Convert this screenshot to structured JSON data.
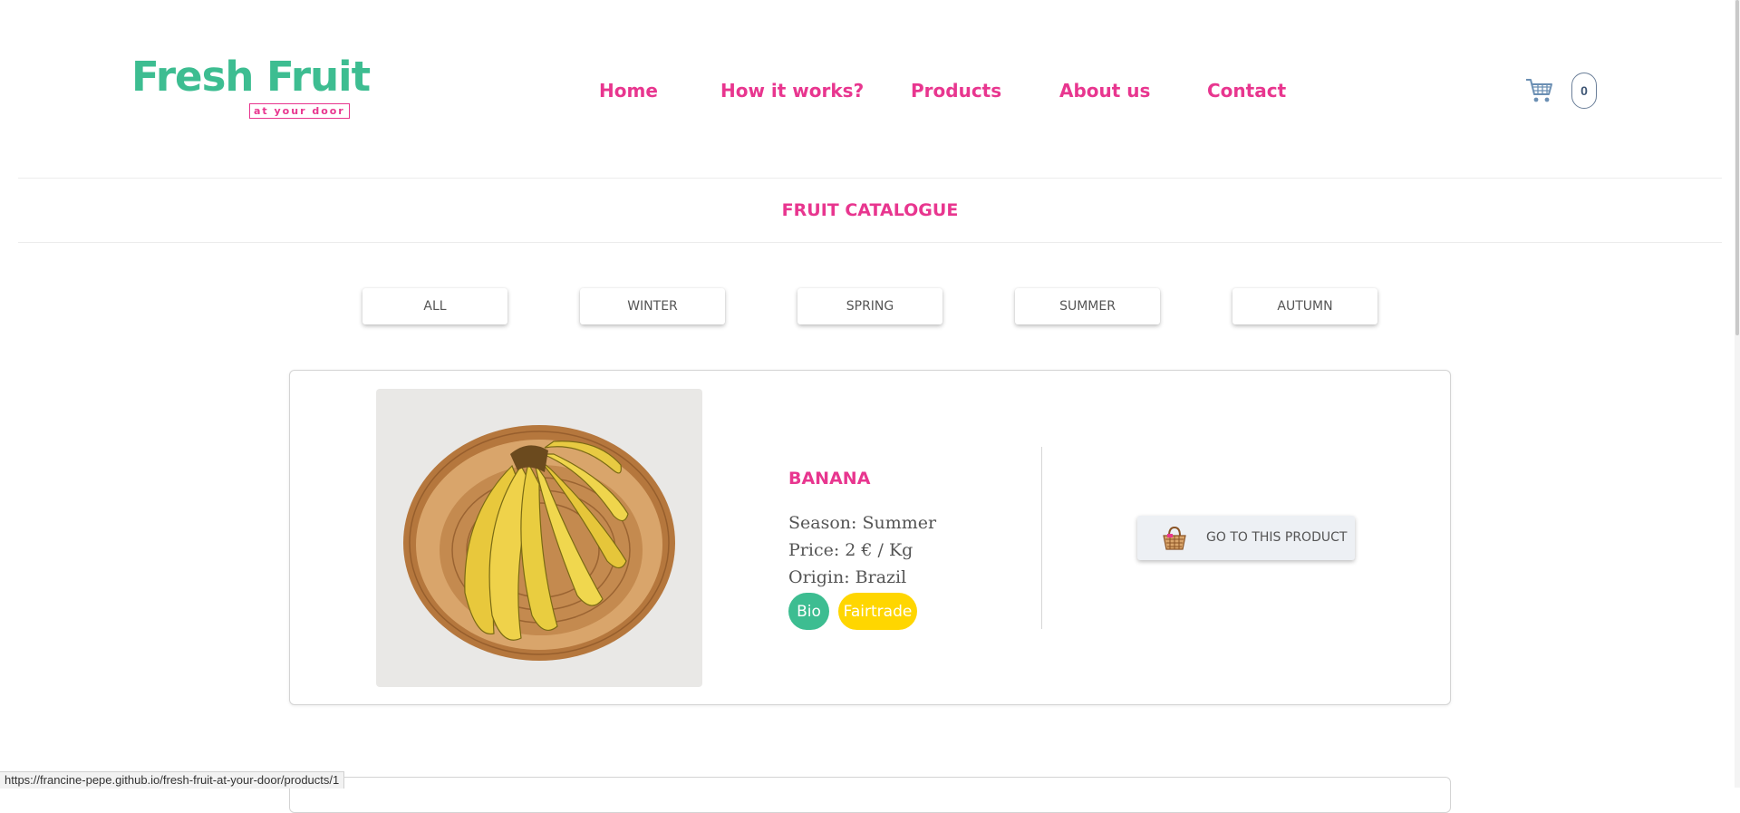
{
  "header": {
    "logo_title": "Fresh Fruit",
    "logo_subtitle": "at your door",
    "nav": [
      "Home",
      "How it works?",
      "Products",
      "About us",
      "Contact"
    ],
    "cart_count": "0",
    "cart_icon": "shopping-cart-icon"
  },
  "catalogue": {
    "title": "FRUIT CATALOGUE",
    "filters": [
      "ALL",
      "WINTER",
      "SPRING",
      "SUMMER",
      "AUTUMN"
    ]
  },
  "product": {
    "name": "BANANA",
    "season": "Season: Summer",
    "price": "Price: 2 € / Kg",
    "origin": "Origin: Brazil",
    "tags": [
      "Bio",
      "Fairtrade"
    ],
    "button_label": "GO TO THIS PRODUCT",
    "button_icon": "basket-icon"
  },
  "status_bar": {
    "url": "https://francine-pepe.github.io/fresh-fruit-at-your-door/products/1"
  },
  "colors": {
    "brand_green": "#3dbd91",
    "brand_pink": "#e8368f",
    "tag_bio": "#3dbd91",
    "tag_fairtrade": "#ffd600"
  }
}
